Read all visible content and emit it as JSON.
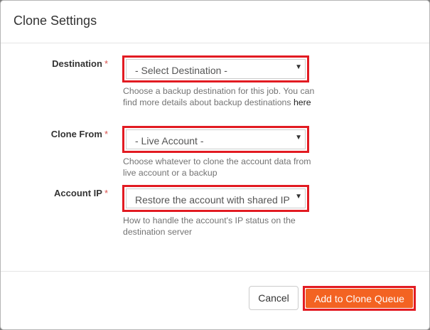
{
  "modal": {
    "title": "Clone Settings"
  },
  "fields": {
    "destination": {
      "label": "Destination",
      "required_mark": "*",
      "selected": "- Select Destination -",
      "help": "Choose a backup destination for this job. You can find more details about backup destinations ",
      "help_link": "here"
    },
    "clone_from": {
      "label": "Clone From",
      "required_mark": "*",
      "selected": "- Live Account -",
      "help": "Choose whatever to clone the account data from live account or a backup"
    },
    "account_ip": {
      "label": "Account IP",
      "required_mark": "*",
      "selected": "Restore the account with shared IP",
      "help": "How to handle the account's IP status on the destination server"
    }
  },
  "footer": {
    "cancel_label": "Cancel",
    "submit_label": "Add to Clone Queue"
  },
  "icons": {
    "select_arrow": "caret-down-icon"
  },
  "colors": {
    "highlight_border": "#e21b22",
    "primary_button": "#f36322",
    "required_star": "#d9534f"
  }
}
